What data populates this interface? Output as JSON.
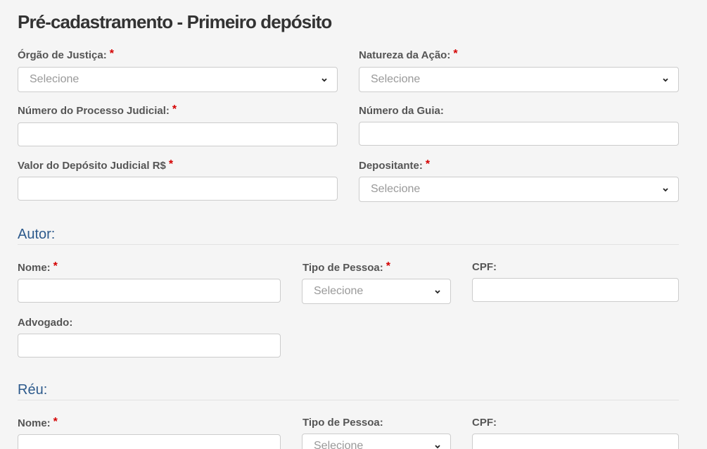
{
  "page": {
    "title": "Pré-cadastramento - Primeiro depósito"
  },
  "required_mark": "*",
  "select_placeholder": "Selecione",
  "fields": {
    "orgao_justica": {
      "label": "Órgão de Justiça:",
      "value": "Selecione"
    },
    "natureza_acao": {
      "label": "Natureza da Ação:",
      "value": "Selecione"
    },
    "numero_processo": {
      "label": "Número do Processo Judicial:",
      "value": ""
    },
    "numero_guia": {
      "label": "Número da Guia:",
      "value": ""
    },
    "valor_deposito": {
      "label": "Valor do Depósito Judicial R$",
      "value": ""
    },
    "depositante": {
      "label": "Depositante:",
      "value": "Selecione"
    }
  },
  "autor": {
    "heading": "Autor:",
    "nome": {
      "label": "Nome:",
      "value": ""
    },
    "tipo_pessoa": {
      "label": "Tipo de Pessoa:",
      "value": "Selecione"
    },
    "cpf": {
      "label": "CPF:",
      "value": ""
    },
    "advogado": {
      "label": "Advogado:",
      "value": ""
    }
  },
  "reu": {
    "heading": "Réu:",
    "nome": {
      "label": "Nome:",
      "value": ""
    },
    "tipo_pessoa": {
      "label": "Tipo de Pessoa:",
      "value": "Selecione"
    },
    "cpf": {
      "label": "CPF:",
      "value": ""
    }
  },
  "icons": {
    "select_arrow": "chevron-down-icon"
  },
  "colors": {
    "background": "#f5f5f5",
    "title": "#333333",
    "label": "#555555",
    "required": "#d40000",
    "section_heading": "#2d5a8c",
    "placeholder": "#999999",
    "border": "#cccccc"
  }
}
